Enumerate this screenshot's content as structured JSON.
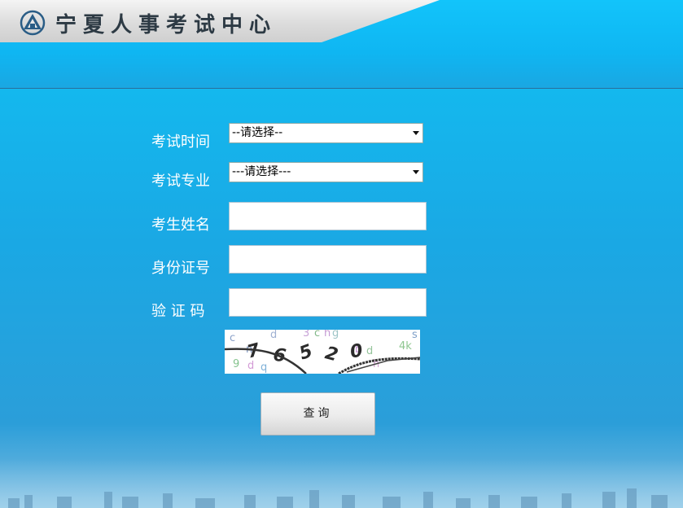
{
  "header": {
    "site_title": "宁夏人事考试中心"
  },
  "form": {
    "exam_time_label": "考试时间",
    "exam_time_selected": "--请选择--",
    "exam_major_label": "考试专业",
    "exam_major_selected": "---请选择---",
    "name_label": "考生姓名",
    "name_value": "",
    "id_label": "身份证号",
    "id_value": "",
    "captcha_label": "验 证 码",
    "captcha_value": "",
    "captcha_text": "76520",
    "submit_label": "查询"
  }
}
